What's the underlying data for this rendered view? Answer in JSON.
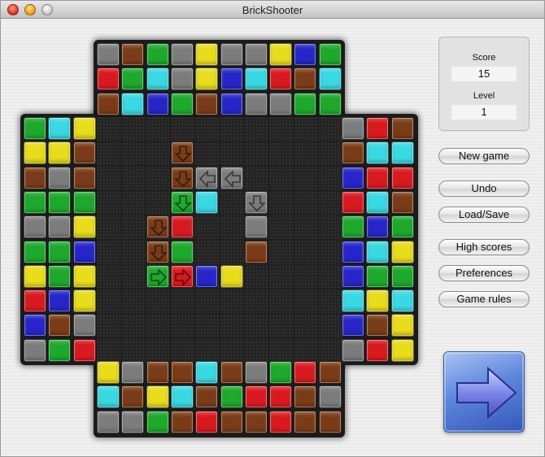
{
  "window": {
    "title": "BrickShooter"
  },
  "score_panel": {
    "score_label": "Score",
    "score_value": "15",
    "level_label": "Level",
    "level_value": "1"
  },
  "buttons": {
    "new_game": "New game",
    "undo": "Undo",
    "load_save": "Load/Save",
    "high_scores": "High scores",
    "preferences": "Preferences",
    "game_rules": "Game rules"
  },
  "colors": {
    "gray": "#7c7c7c",
    "brown": "#7a3c18",
    "green": "#1ea82c",
    "yellow": "#e8dc1c",
    "red": "#d81a20",
    "cyan": "#3ad8e2",
    "blue": "#2626c8",
    "board_background": "#242424",
    "shoot_button": "#4a72d0"
  },
  "brick_legend": {
    "G": "gray",
    "B": "brown",
    "N": "green",
    "Y": "yellow",
    "R": "red",
    "C": "cyan",
    "U": "blue"
  },
  "top_stock": [
    "GBNGYGGYUN",
    "RNCGYUCRBC",
    "BCUNBUGGNN"
  ],
  "bottom_stock": [
    "YGBBCBGNRB",
    "CBYCBNRRBG",
    "GGNBRBBRBB"
  ],
  "left_stock": [
    "NCY",
    "YYB",
    "BGB",
    "NNN",
    "GGY",
    "NNU",
    "YNY",
    "RUY",
    "UBG",
    "GNR"
  ],
  "right_stock": [
    "GRB",
    "BCC",
    "URR",
    "RCB",
    "NUN",
    "UCY",
    "UNN",
    "CYC",
    "UBY",
    "GRY"
  ],
  "field_bricks": [
    {
      "row": 1,
      "col": 3,
      "color": "brown",
      "arrow": "down"
    },
    {
      "row": 2,
      "col": 3,
      "color": "brown",
      "arrow": "down"
    },
    {
      "row": 2,
      "col": 4,
      "color": "gray",
      "arrow": "left"
    },
    {
      "row": 2,
      "col": 5,
      "color": "gray",
      "arrow": "left"
    },
    {
      "row": 3,
      "col": 3,
      "color": "green",
      "arrow": "down"
    },
    {
      "row": 3,
      "col": 4,
      "color": "cyan",
      "arrow": ""
    },
    {
      "row": 3,
      "col": 6,
      "color": "gray",
      "arrow": "down"
    },
    {
      "row": 4,
      "col": 2,
      "color": "brown",
      "arrow": "down"
    },
    {
      "row": 4,
      "col": 3,
      "color": "red",
      "arrow": ""
    },
    {
      "row": 4,
      "col": 6,
      "color": "gray",
      "arrow": ""
    },
    {
      "row": 5,
      "col": 2,
      "color": "brown",
      "arrow": "down"
    },
    {
      "row": 5,
      "col": 3,
      "color": "green",
      "arrow": ""
    },
    {
      "row": 5,
      "col": 6,
      "color": "brown",
      "arrow": ""
    },
    {
      "row": 6,
      "col": 2,
      "color": "green",
      "arrow": "right"
    },
    {
      "row": 6,
      "col": 3,
      "color": "red",
      "arrow": "right"
    },
    {
      "row": 6,
      "col": 4,
      "color": "blue",
      "arrow": ""
    },
    {
      "row": 6,
      "col": 5,
      "color": "yellow",
      "arrow": ""
    }
  ],
  "shoot_icon": "right-arrow-icon"
}
